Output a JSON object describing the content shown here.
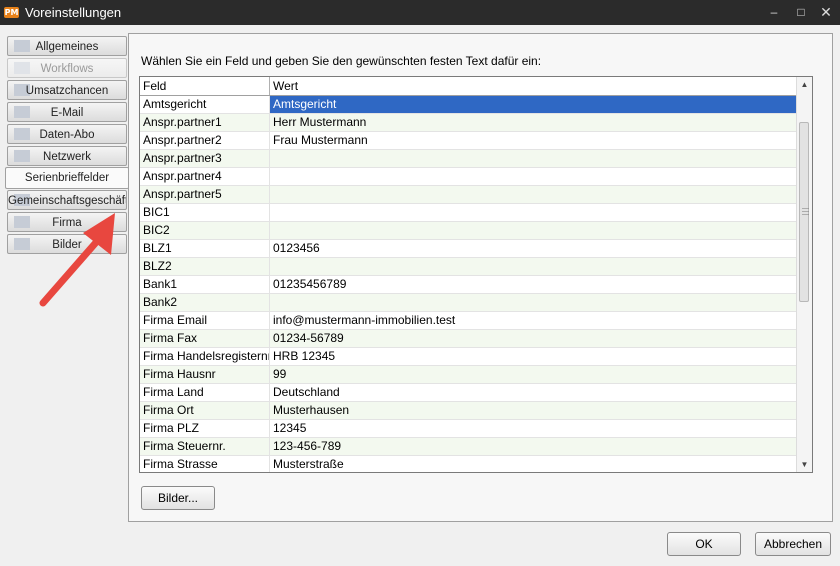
{
  "window": {
    "title": "Voreinstellungen",
    "app_icon_text": "PM",
    "controls": [
      "minimize",
      "maximize",
      "close"
    ]
  },
  "sidebar": {
    "items": [
      {
        "label": "Allgemeines",
        "state": "normal"
      },
      {
        "label": "Workflows",
        "state": "disabled"
      },
      {
        "label": "Umsatzchancen",
        "state": "normal"
      },
      {
        "label": "E-Mail",
        "state": "normal"
      },
      {
        "label": "Daten-Abo",
        "state": "normal"
      },
      {
        "label": "Netzwerk",
        "state": "normal"
      },
      {
        "label": "Serienbrieffelder",
        "state": "active"
      },
      {
        "label": "Gemeinschaftsgeschäft",
        "state": "normal"
      },
      {
        "label": "Firma",
        "state": "normal"
      },
      {
        "label": "Bilder",
        "state": "normal"
      }
    ]
  },
  "main": {
    "instruction": "Wählen Sie ein Feld und geben Sie den gewünschten festen Text dafür ein:",
    "grid": {
      "columns": [
        "Feld",
        "Wert"
      ],
      "selected_row": 0,
      "rows": [
        [
          "Amtsgericht",
          "Amtsgericht"
        ],
        [
          "Anspr.partner1",
          "Herr Mustermann"
        ],
        [
          "Anspr.partner2",
          "Frau Mustermann"
        ],
        [
          "Anspr.partner3",
          ""
        ],
        [
          "Anspr.partner4",
          ""
        ],
        [
          "Anspr.partner5",
          ""
        ],
        [
          "BIC1",
          ""
        ],
        [
          "BIC2",
          ""
        ],
        [
          "BLZ1",
          "0123456"
        ],
        [
          "BLZ2",
          ""
        ],
        [
          "Bank1",
          "01235456789"
        ],
        [
          "Bank2",
          ""
        ],
        [
          "Firma Email",
          "info@mustermann-immobilien.test"
        ],
        [
          "Firma Fax",
          "01234-56789"
        ],
        [
          "Firma Handelsregisternr.",
          "HRB 12345"
        ],
        [
          "Firma Hausnr",
          "99"
        ],
        [
          "Firma Land",
          "Deutschland"
        ],
        [
          "Firma Ort",
          "Musterhausen"
        ],
        [
          "Firma PLZ",
          "12345"
        ],
        [
          "Firma Steuernr.",
          "123-456-789"
        ],
        [
          "Firma Strasse",
          "Musterstraße"
        ]
      ]
    },
    "bilder_button": "Bilder..."
  },
  "footer": {
    "ok_label": "OK",
    "cancel_label": "Abbrechen"
  },
  "colors": {
    "titlebar": "#2b2b2b",
    "selection": "#2f68c4",
    "alt_row": "#f3f9ef",
    "annotation_arrow": "#e8473f"
  }
}
